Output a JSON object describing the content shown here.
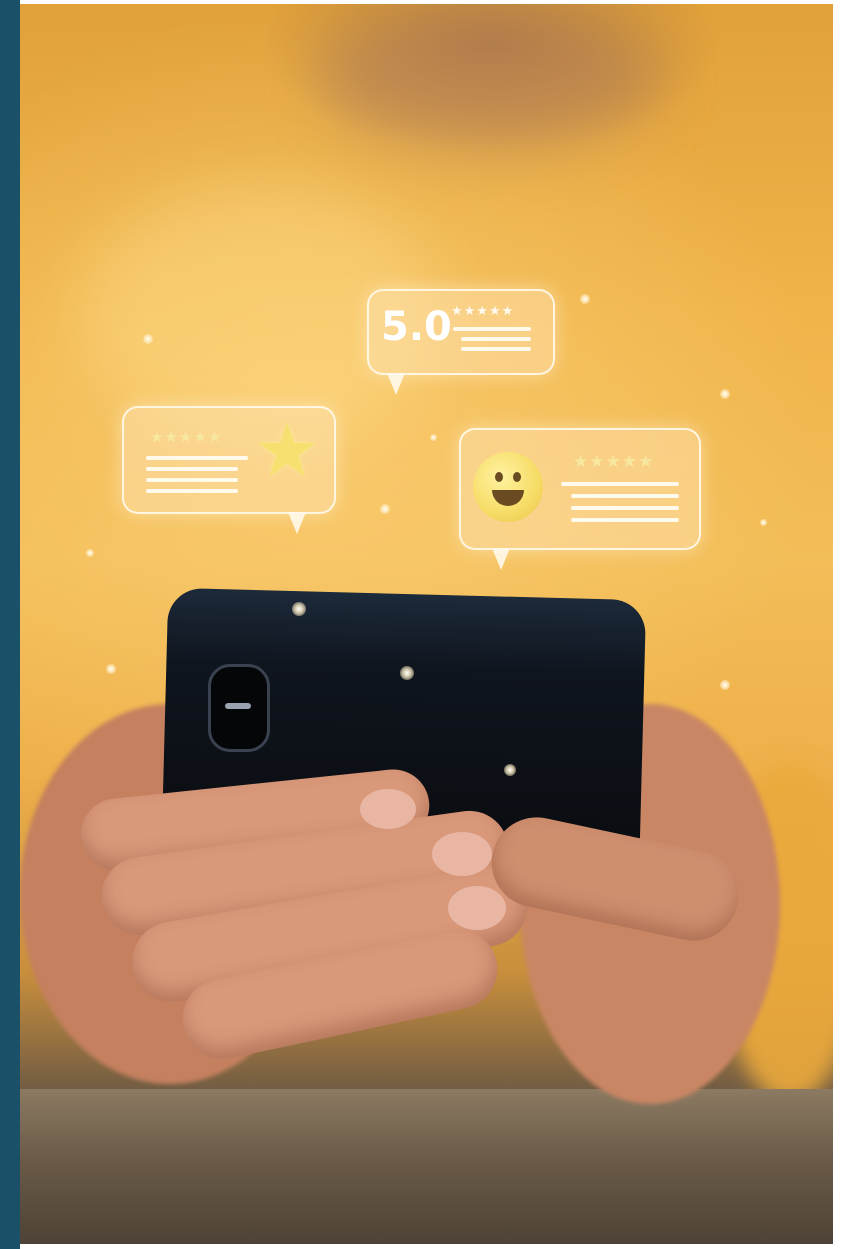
{
  "colors": {
    "sidebar": "#1a5068",
    "background_orange": "#f0b44a",
    "bubble_border": "#fffaeb",
    "star_yellow": "#f6e070",
    "phone": "#0f151e"
  },
  "review_bubbles": [
    {
      "position": "top-center",
      "rating_value": "5.0",
      "stars": "★★★★★",
      "icon": "rating-text"
    },
    {
      "position": "left",
      "stars": "★★★★★",
      "icon": "smiling-star-icon"
    },
    {
      "position": "right",
      "stars": "★★★★★",
      "icon": "smiley-face-icon"
    }
  ]
}
